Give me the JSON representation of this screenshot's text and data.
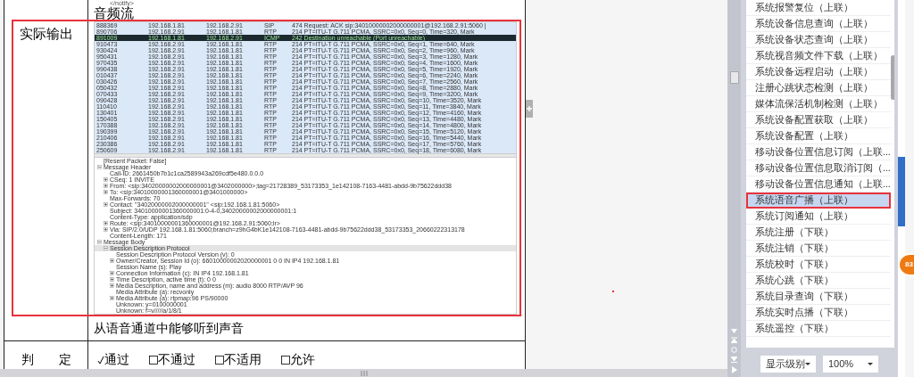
{
  "document": {
    "row_label": "实际输出",
    "code_line": "</notify>\r\n",
    "section_title": "音频流",
    "capture": {
      "packets": [
        {
          "no": "888369",
          "src": "192.168.1.81",
          "dst": "192.168.2.91",
          "proto": "SIP",
          "info": "474 Request: ACK sip:34010000002000000001@192.168.2.91:5060 |",
          "selected": false
        },
        {
          "no": "890706",
          "src": "192.168.2.91",
          "dst": "192.168.1.81",
          "proto": "RTP",
          "info": "214 PT=ITU-T G.711 PCMA, SSRC=0x0, Seq=0, Time=320, Mark",
          "selected": false
        },
        {
          "no": "891009",
          "src": "192.168.1.81",
          "dst": "192.168.2.91",
          "proto": "ICMP",
          "info": "242 Destination unreachable (Port unreachable)",
          "selected": true
        },
        {
          "no": "910473",
          "src": "192.168.2.91",
          "dst": "192.168.1.81",
          "proto": "RTP",
          "info": "214 PT=ITU-T G.711 PCMA, SSRC=0x0, Seq=1, Time=640, Mark",
          "selected": false
        },
        {
          "no": "930424",
          "src": "192.168.2.91",
          "dst": "192.168.1.81",
          "proto": "RTP",
          "info": "214 PT=ITU-T G.711 PCMA, SSRC=0x0, Seq=2, Time=960, Mark",
          "selected": false
        },
        {
          "no": "950431",
          "src": "192.168.2.91",
          "dst": "192.168.1.81",
          "proto": "RTP",
          "info": "214 PT=ITU-T G.711 PCMA, SSRC=0x0, Seq=3, Time=1280, Mark",
          "selected": false
        },
        {
          "no": "970435",
          "src": "192.168.2.91",
          "dst": "192.168.1.81",
          "proto": "RTP",
          "info": "214 PT=ITU-T G.711 PCMA, SSRC=0x0, Seq=4, Time=1600, Mark",
          "selected": false
        },
        {
          "no": "990438",
          "src": "192.168.2.91",
          "dst": "192.168.1.81",
          "proto": "RTP",
          "info": "214 PT=ITU-T G.711 PCMA, SSRC=0x0, Seq=5, Time=1920, Mark",
          "selected": false
        },
        {
          "no": "010437",
          "src": "192.168.2.91",
          "dst": "192.168.1.81",
          "proto": "RTP",
          "info": "214 PT=ITU-T G.711 PCMA, SSRC=0x0, Seq=6, Time=2240, Mark",
          "selected": false
        },
        {
          "no": "030426",
          "src": "192.168.2.91",
          "dst": "192.168.1.81",
          "proto": "RTP",
          "info": "214 PT=ITU-T G.711 PCMA, SSRC=0x0, Seq=7, Time=2560, Mark",
          "selected": false
        },
        {
          "no": "050432",
          "src": "192.168.2.91",
          "dst": "192.168.1.81",
          "proto": "RTP",
          "info": "214 PT=ITU-T G.711 PCMA, SSRC=0x0, Seq=8, Time=2880, Mark",
          "selected": false
        },
        {
          "no": "070433",
          "src": "192.168.2.91",
          "dst": "192.168.1.81",
          "proto": "RTP",
          "info": "214 PT=ITU-T G.711 PCMA, SSRC=0x0, Seq=9, Time=3200, Mark",
          "selected": false
        },
        {
          "no": "090428",
          "src": "192.168.2.91",
          "dst": "192.168.1.81",
          "proto": "RTP",
          "info": "214 PT=ITU-T G.711 PCMA, SSRC=0x0, Seq=10, Time=3520, Mark",
          "selected": false
        },
        {
          "no": "110410",
          "src": "192.168.2.91",
          "dst": "192.168.1.81",
          "proto": "RTP",
          "info": "214 PT=ITU-T G.711 PCMA, SSRC=0x0, Seq=11, Time=3840, Mark",
          "selected": false
        },
        {
          "no": "130401",
          "src": "192.168.2.91",
          "dst": "192.168.1.81",
          "proto": "RTP",
          "info": "214 PT=ITU-T G.711 PCMA, SSRC=0x0, Seq=12, Time=4160, Mark",
          "selected": false
        },
        {
          "no": "150405",
          "src": "192.168.2.91",
          "dst": "192.168.1.81",
          "proto": "RTP",
          "info": "214 PT=ITU-T G.711 PCMA, SSRC=0x0, Seq=13, Time=4480, Mark",
          "selected": false
        },
        {
          "no": "170388",
          "src": "192.168.2.91",
          "dst": "192.168.1.81",
          "proto": "RTP",
          "info": "214 PT=ITU-T G.711 PCMA, SSRC=0x0, Seq=14, Time=4800, Mark",
          "selected": false
        },
        {
          "no": "190399",
          "src": "192.168.2.91",
          "dst": "192.168.1.81",
          "proto": "RTP",
          "info": "214 PT=ITU-T G.711 PCMA, SSRC=0x0, Seq=15, Time=5120, Mark",
          "selected": false
        },
        {
          "no": "210406",
          "src": "192.168.2.91",
          "dst": "192.168.1.81",
          "proto": "RTP",
          "info": "214 PT=ITU-T G.711 PCMA, SSRC=0x0, Seq=16, Time=5440, Mark",
          "selected": false
        },
        {
          "no": "230386",
          "src": "192.168.2.91",
          "dst": "192.168.1.81",
          "proto": "RTP",
          "info": "214 PT=ITU-T G.711 PCMA, SSRC=0x0, Seq=17, Time=5760, Mark",
          "selected": false
        },
        {
          "no": "250609",
          "src": "192.168.2.91",
          "dst": "192.168.1.81",
          "proto": "RTP",
          "info": "214 PT=ITU-T G.711 PCMA, SSRC=0x0, Seq=18, Time=6080, Mark",
          "selected": false
        }
      ],
      "details": [
        {
          "text": "[Resent Packet: False]"
        },
        {
          "text": "Message Header",
          "expanded": true,
          "children": [
            {
              "text": "Call-ID: 2661450b7b1c1ca2589943a269cdf5e480.0.0.0"
            },
            {
              "text": "CSeq: 1 INVITE",
              "expanded": false
            },
            {
              "text": "From: <sip:34020000002000000001@3402000000>;tag=21728389_53173353_1e142108-7163-4481-abdd-9b75622ddd38",
              "expanded": false
            },
            {
              "text": "To: <sip:34010000001360000001@3401000000>",
              "expanded": false
            },
            {
              "text": "Max-Forwards: 70"
            },
            {
              "text": "Contact: \"34020000002000000001\" <sip:192.168.1.81:5060>",
              "expanded": false
            },
            {
              "text": "Subject: 34010000001360000001:0-4-0,34020000002000000001:1"
            },
            {
              "text": "Content-Type: application/sdp"
            },
            {
              "text": "Route: <sip:34010000001360000001@192.168.2.91:5060;lr>",
              "expanded": false
            },
            {
              "text": "Via: SIP/2.0/UDP 192.168.1.81:5060;branch=z9hG4bK1e142108-7163-4481-abdd-9b75622ddd38_53173353_20660222313178",
              "expanded": false
            },
            {
              "text": "Content-Length: 171"
            }
          ]
        },
        {
          "text": "Message Body",
          "expanded": true,
          "children": [
            {
              "text": "Session Description Protocol",
              "expanded": true,
              "selected": true,
              "children": [
                {
                  "text": "Session Description Protocol Version (v): 0"
                },
                {
                  "text": "Owner/Creator, Session Id (o): 66010000002020000001 0 0 IN IP4 192.168.1.81",
                  "expanded": false
                },
                {
                  "text": "Session Name (s): Play"
                },
                {
                  "text": "Connection Information (c): IN IP4 192.168.1.81",
                  "expanded": false
                },
                {
                  "text": "Time Description, active time (t): 0 0",
                  "expanded": false
                },
                {
                  "text": "Media Description, name and address (m): audio 8000 RTP/AVP 96",
                  "expanded": false
                },
                {
                  "text": "Media Attribute (a): recvonly"
                },
                {
                  "text": "Media Attribute (a): rtpmap:96 PS/90000",
                  "expanded": false
                },
                {
                  "text": "Unknown: y=0100000001"
                },
                {
                  "text": "Unknown: f=v/////a/1/8/1"
                }
              ]
            }
          ]
        }
      ]
    },
    "conclusion": "从语音通道中能够听到声音",
    "verdict_label": "判　　定",
    "verdict_options": [
      {
        "label": "通过",
        "checked": true
      },
      {
        "label": "不通过",
        "checked": false
      },
      {
        "label": "不适用",
        "checked": false
      },
      {
        "label": "允许",
        "checked": false
      }
    ]
  },
  "sidebar": {
    "items": [
      {
        "label": "系统报警复位（上联）",
        "selected": false
      },
      {
        "label": "系统设备信息查询（上联）",
        "selected": false
      },
      {
        "label": "系统设备状态查询（上联）",
        "selected": false
      },
      {
        "label": "系统视音频文件下载（上联）",
        "selected": false
      },
      {
        "label": "系统设备远程启动（上联）",
        "selected": false
      },
      {
        "label": "注册心跳状态检测（上联）",
        "selected": false
      },
      {
        "label": "媒体流保活机制检测（上联）",
        "selected": false
      },
      {
        "label": "系统设备配置获取（上联）",
        "selected": false
      },
      {
        "label": "系统设备配置（上联）",
        "selected": false
      },
      {
        "label": "移动设备位置信息订阅（上联...",
        "selected": false
      },
      {
        "label": "移动设备位置信息取消订阅（...",
        "selected": false
      },
      {
        "label": "移动设备位置信息通知（上联...",
        "selected": false
      },
      {
        "label": "系统语音广播（上联）",
        "selected": true
      },
      {
        "label": "系统订阅通知（上联）",
        "selected": false
      },
      {
        "label": "系统注册（下联）",
        "selected": false
      },
      {
        "label": "系统注销（下联）",
        "selected": false
      },
      {
        "label": "系统校时（下联）",
        "selected": false
      },
      {
        "label": "系统心跳（下联）",
        "selected": false
      },
      {
        "label": "系统目录查询（下联）",
        "selected": false
      },
      {
        "label": "系统实时点播（下联）",
        "selected": false
      },
      {
        "label": "系统遥控（下联）",
        "selected": false
      }
    ],
    "level_select": "显示级别",
    "zoom_select": "100%"
  },
  "badge": "83"
}
